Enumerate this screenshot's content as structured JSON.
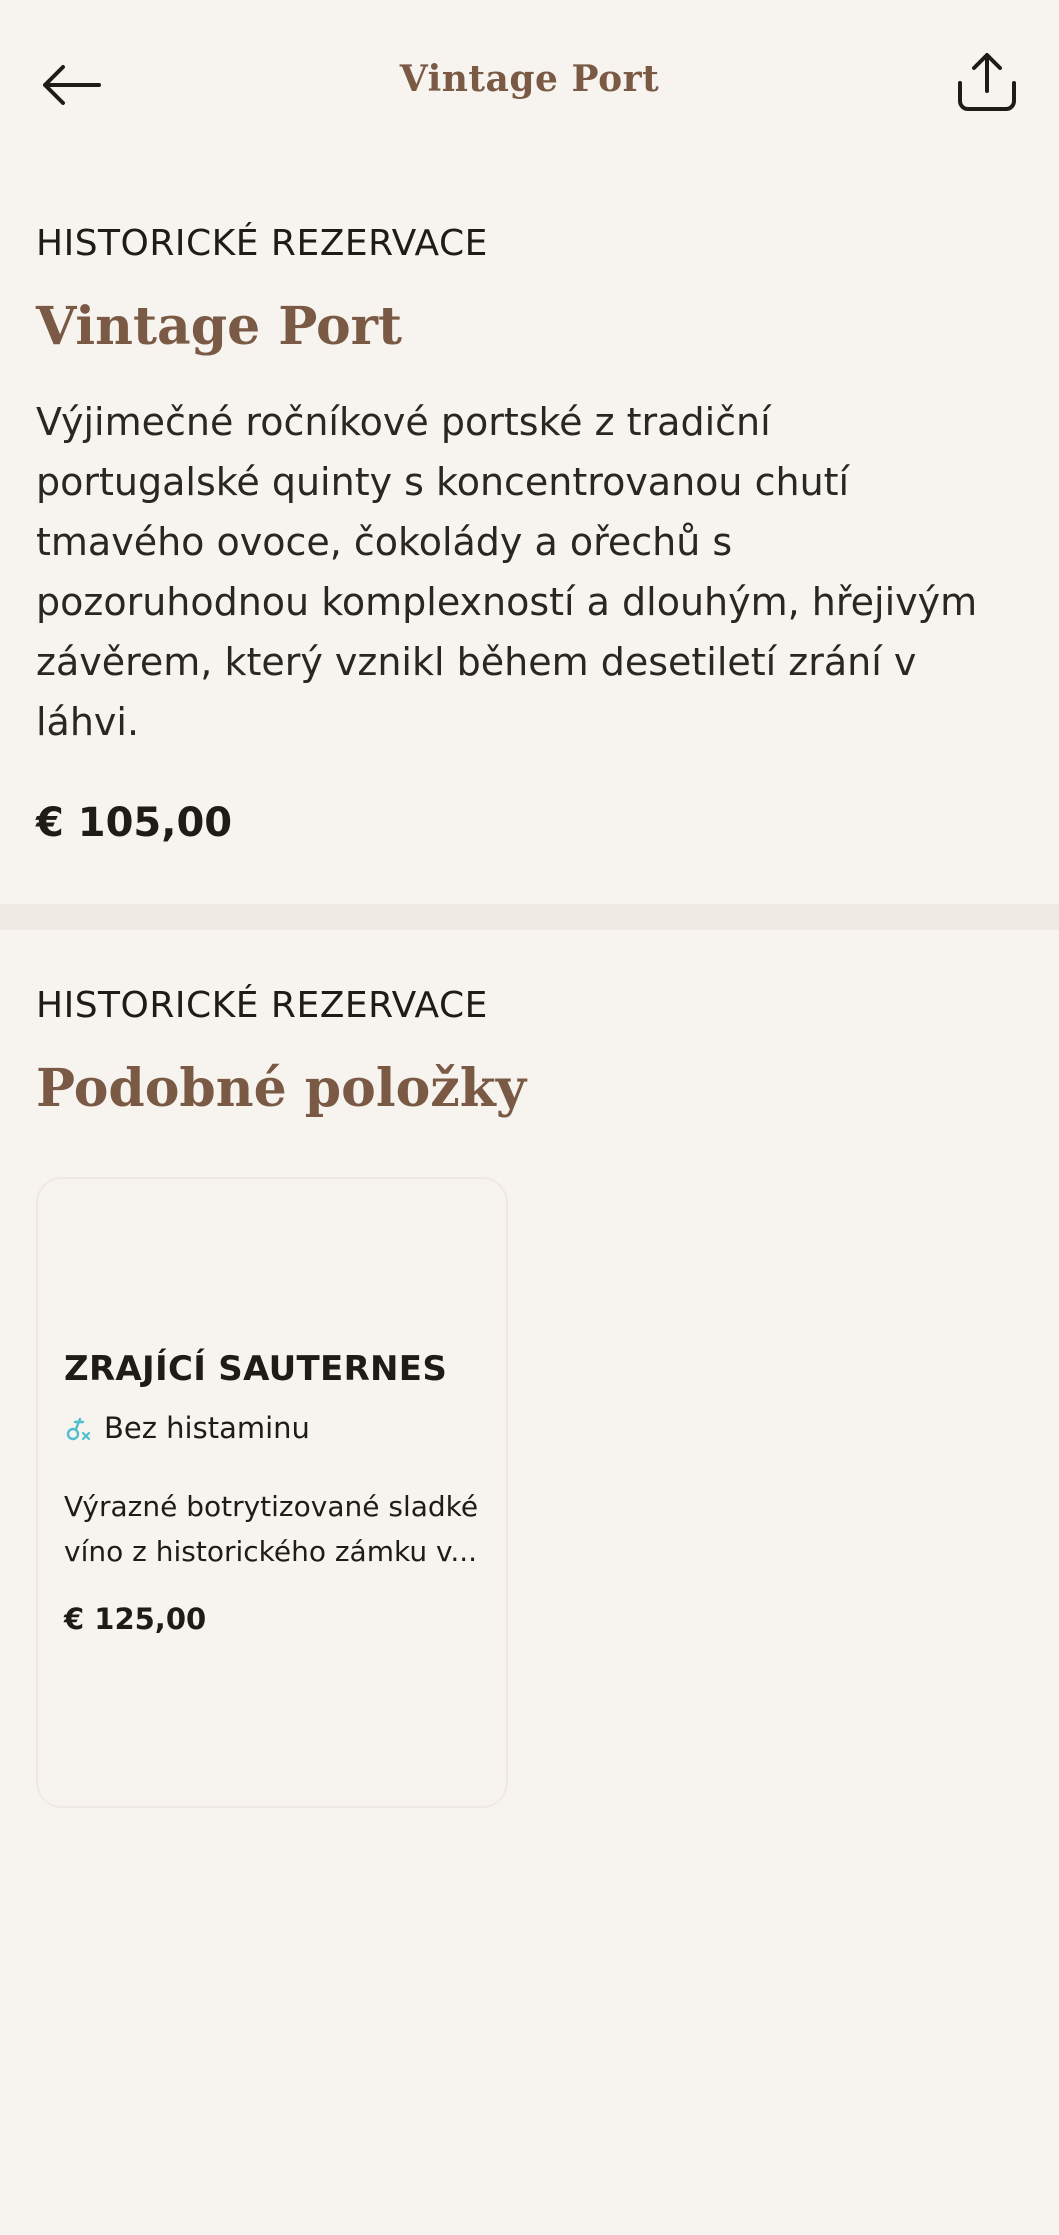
{
  "header": {
    "title": "Vintage Port",
    "back_icon": "arrow-left-icon",
    "share_icon": "share-icon"
  },
  "product": {
    "eyebrow": "HISTORICKÉ REZERVACE",
    "name": "Vintage Port",
    "description_lines": [
      "Výjimečné ročníkové portské z tradiční",
      "portugalské quinty s koncentrovanou chutí",
      "tmavého ovoce, čokolády a ořechů s",
      "pozoruhodnou komplexností a dlouhým, hřejivým",
      "závěrem, který vznikl během desetiletí zrání v",
      "láhvi."
    ],
    "price": "€ 105,00"
  },
  "similar": {
    "eyebrow": "HISTORICKÉ REZERVACE",
    "heading": "Podobné položky",
    "items": [
      {
        "name": "ZRAJÍCÍ SAUTERNES",
        "tag": "Bez histaminu",
        "tag_icon": "no-histamine-icon",
        "description_lines": [
          "Výrazné botrytizované sladké",
          "víno z historického zámku v..."
        ],
        "price": "€ 125,00"
      }
    ]
  },
  "colors": {
    "background": "#f7f4ef",
    "accent": "#7a5a45",
    "text": "#1f1c17",
    "divider": "#efebe4",
    "tag_icon": "#4fbfd0"
  }
}
